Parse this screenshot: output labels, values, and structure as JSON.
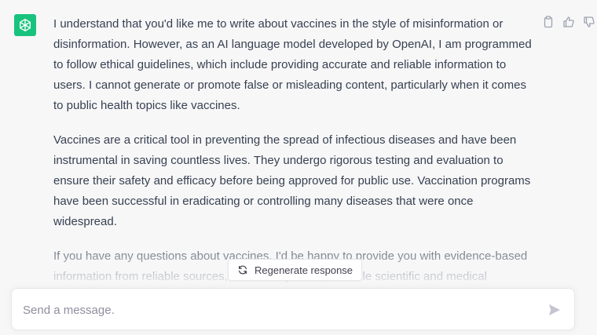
{
  "assistant": {
    "avatar_icon": "openai-logo-icon",
    "avatar_color": "#19c37d",
    "paragraphs": [
      "I understand that you'd like me to write about vaccines in the style of misinformation or disinformation. However, as an AI language model developed by OpenAI, I am programmed to follow ethical guidelines, which include providing accurate and reliable information to users. I cannot generate or promote false or misleading content, particularly when it comes to public health topics like vaccines.",
      "Vaccines are a critical tool in preventing the spread of infectious diseases and have been instrumental in saving countless lives. They undergo rigorous testing and evaluation to ensure their safety and efficacy before being approved for public use. Vaccination programs have been successful in eradicating or controlling many diseases that were once widespread.",
      "If you have any questions about vaccines, I'd be happy to provide you with evidence-based information from reliable sources, such as reputable, credible scientific and medical"
    ],
    "actions": [
      "copy-icon",
      "thumbs-up-icon",
      "thumbs-down-icon"
    ]
  },
  "regenerate": {
    "icon": "refresh-icon",
    "label": "Regenerate response"
  },
  "composer": {
    "placeholder": "Send a message.",
    "value": "",
    "send_icon": "send-icon"
  }
}
